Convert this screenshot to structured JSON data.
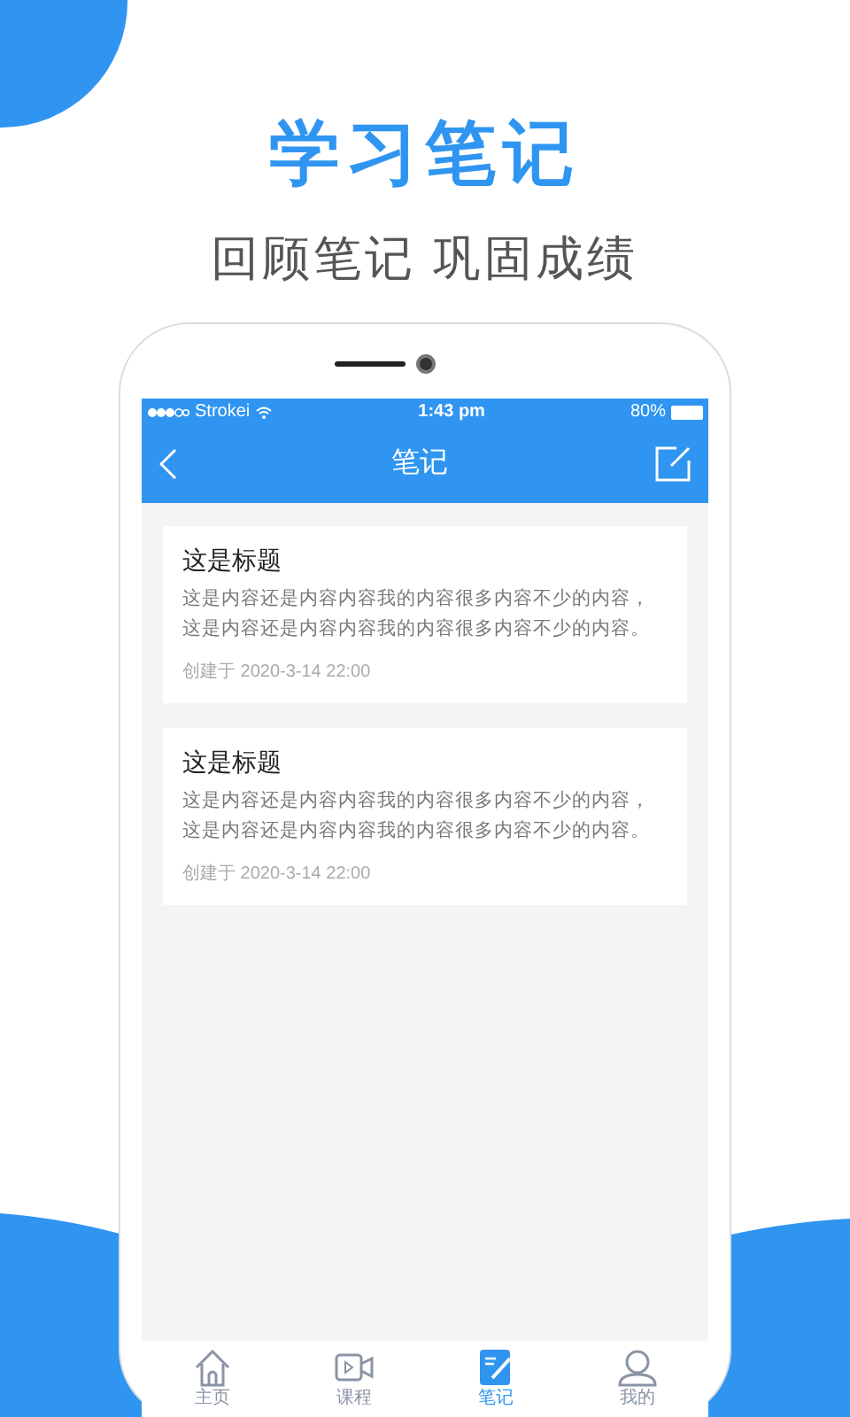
{
  "headline": "学习笔记",
  "subheadline": "回顾笔记 巩固成绩",
  "status_bar": {
    "carrier": "Strokei",
    "time": "1:43 pm",
    "battery": "80%"
  },
  "nav": {
    "title": "笔记"
  },
  "notes": [
    {
      "title": "这是标题",
      "body": "这是内容还是内容内容我的内容很多内容不少的内容，这是内容还是内容内容我的内容很多内容不少的内容。",
      "created": "创建于 2020-3-14 22:00"
    },
    {
      "title": "这是标题",
      "body": "这是内容还是内容内容我的内容很多内容不少的内容，这是内容还是内容内容我的内容很多内容不少的内容。",
      "created": "创建于 2020-3-14 22:00"
    }
  ],
  "tabs": [
    {
      "label": "主页",
      "kind": "home",
      "selected": false
    },
    {
      "label": "课程",
      "kind": "video",
      "selected": false
    },
    {
      "label": "笔记",
      "kind": "note",
      "selected": true
    },
    {
      "label": "我的",
      "kind": "user",
      "selected": false
    }
  ]
}
